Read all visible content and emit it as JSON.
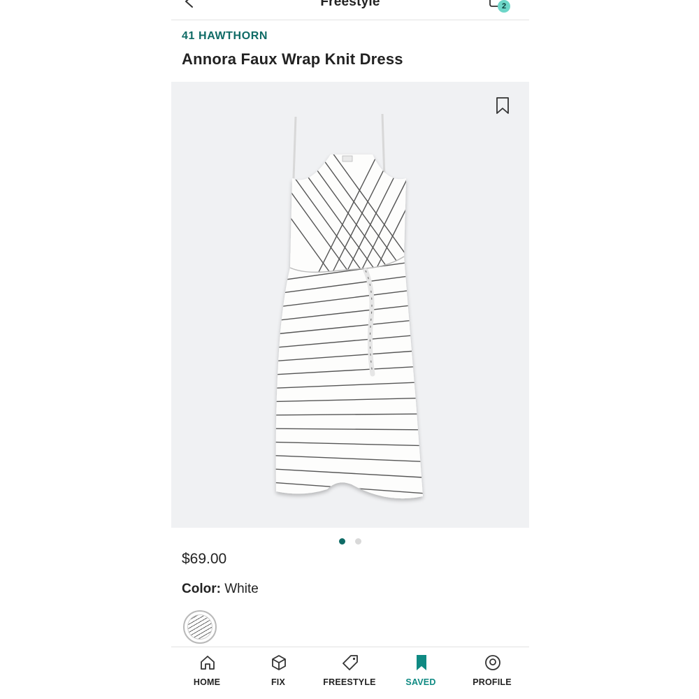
{
  "header": {
    "title": "Freestyle",
    "cart_count": "2"
  },
  "product": {
    "brand": "41 HAWTHORN",
    "name": "Annora Faux Wrap Knit Dress",
    "price": "$69.00",
    "color_label": "Color:",
    "color_value": "White",
    "image_count": 2,
    "current_image": 1
  },
  "tabs": [
    {
      "label": "HOME",
      "icon": "home-icon",
      "active": false
    },
    {
      "label": "FIX",
      "icon": "box-icon",
      "active": false
    },
    {
      "label": "FREESTYLE",
      "icon": "tag-icon",
      "active": false
    },
    {
      "label": "SAVED",
      "icon": "bookmark-icon",
      "active": true
    },
    {
      "label": "PROFILE",
      "icon": "profile-icon",
      "active": false
    }
  ],
  "colors": {
    "accent": "#0f6b66",
    "active_tab": "#0f8a83",
    "badge": "#6dd6c8",
    "image_bg": "#f0f1f3"
  }
}
